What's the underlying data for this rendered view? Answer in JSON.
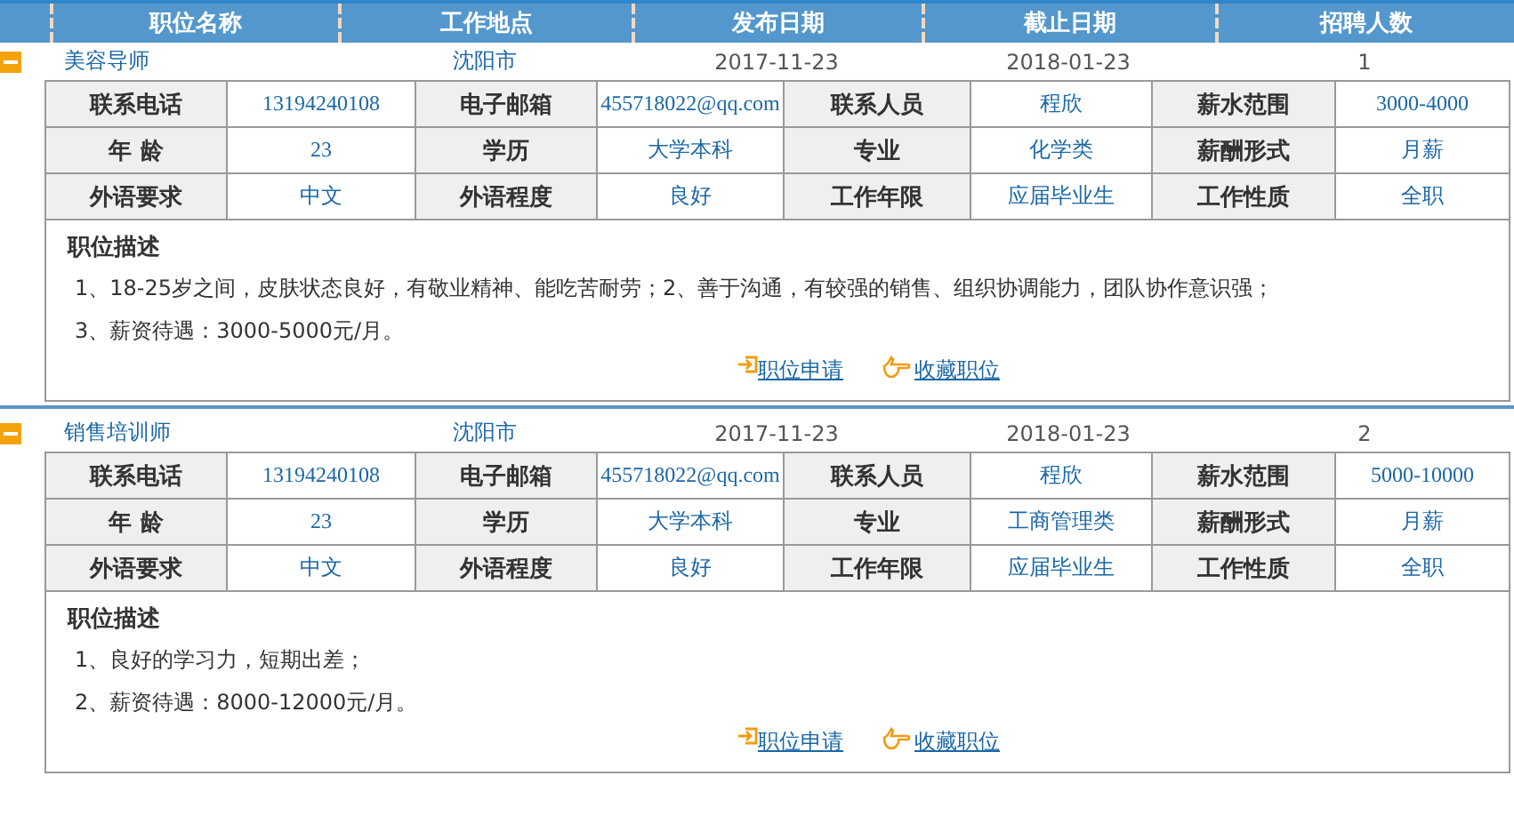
{
  "columns": [
    "职位名称",
    "工作地点",
    "发布日期",
    "截止日期",
    "招聘人数"
  ],
  "jobs": [
    {
      "expanded": true,
      "title": "美容导师",
      "location": "沈阳市",
      "posted": "2017-11-23",
      "deadline": "2018-01-23",
      "count": "1",
      "details": [
        [
          "联系电话",
          "13194240108",
          "电子邮箱",
          "455718022@qq.com",
          "联系人员",
          "程欣",
          "薪水范围",
          "3000-4000"
        ],
        [
          "年 龄",
          "23",
          "学历",
          "大学本科",
          "专业",
          "化学类",
          "薪酬形式",
          "月薪"
        ],
        [
          "外语要求",
          "中文",
          "外语程度",
          "良好",
          "工作年限",
          "应届毕业生",
          "工作性质",
          "全职"
        ]
      ],
      "description_title": "职位描述",
      "description": [
        "1、18-25岁之间，皮肤状态良好，有敬业精神、能吃苦耐劳；2、善于沟通，有较强的销售、组织协调能力，团队协作意识强；",
        "3、薪资待遇：3000-5000元/月。"
      ],
      "apply": "职位申请",
      "save": "收藏职位"
    },
    {
      "expanded": true,
      "title": "销售培训师",
      "location": "沈阳市",
      "posted": "2017-11-23",
      "deadline": "2018-01-23",
      "count": "2",
      "details": [
        [
          "联系电话",
          "13194240108",
          "电子邮箱",
          "455718022@qq.com",
          "联系人员",
          "程欣",
          "薪水范围",
          "5000-10000"
        ],
        [
          "年 龄",
          "23",
          "学历",
          "大学本科",
          "专业",
          "工商管理类",
          "薪酬形式",
          "月薪"
        ],
        [
          "外语要求",
          "中文",
          "外语程度",
          "良好",
          "工作年限",
          "应届毕业生",
          "工作性质",
          "全职"
        ]
      ],
      "description_title": "职位描述",
      "description": [
        "1、良好的学习力，短期出差；",
        "2、薪资待遇：8000-12000元/月。"
      ],
      "apply": "职位申请",
      "save": "收藏职位"
    }
  ]
}
